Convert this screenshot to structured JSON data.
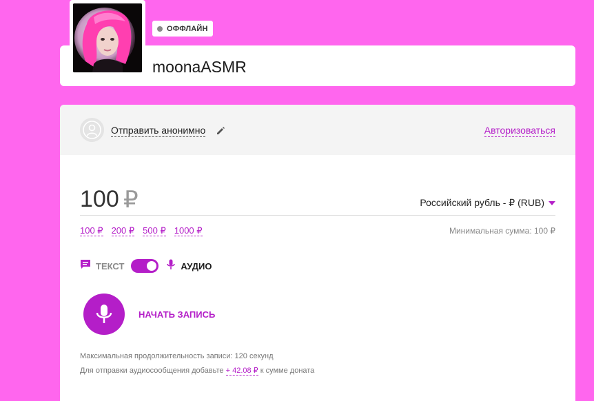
{
  "streamer": {
    "username": "moonaASMR",
    "status": "ОФФЛАЙН",
    "avatar_icon": "streamer-avatar-photo"
  },
  "sender": {
    "send_anonymously": "Отправить анонимно",
    "login_link": "Авторизоваться"
  },
  "amount": {
    "value": "100",
    "currency_symbol": "₽",
    "currency_select": "Российский рубль - ₽ (RUB)",
    "presets": [
      "100 ₽",
      "200 ₽",
      "500 ₽",
      "1000 ₽"
    ],
    "min_sum": "Минимальная сумма: 100 ₽"
  },
  "mode": {
    "text_label": "ТЕКСТ",
    "audio_label": "АУДИО",
    "audio_enabled": true
  },
  "record": {
    "label": "НАЧАТЬ ЗАПИСЬ"
  },
  "hints": {
    "max_duration": "Максимальная продолжительность записи: 120 секунд",
    "audio_fee_prefix": "Для отправки аудиосообщения добавьте",
    "audio_fee_value": "+ 42.08 ₽",
    "audio_fee_suffix": "к сумме доната"
  },
  "colors": {
    "background": "#ff66ee",
    "accent": "#b41ec8"
  }
}
